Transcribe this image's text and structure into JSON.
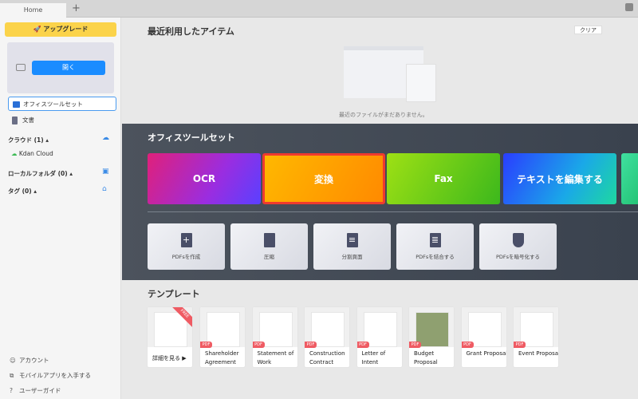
{
  "tabs": {
    "home": "Home",
    "add": "+"
  },
  "sidebar": {
    "upgrade": "アップグレード",
    "open": "開く",
    "items": [
      {
        "label": "オフィスツールセット"
      },
      {
        "label": "文書"
      }
    ],
    "cloud": "クラウド (1) ▴",
    "cloud_item": "Kdan Cloud",
    "local": "ローカルフォルダ (0) ▴",
    "tags": "タグ (0) ▴",
    "footer": [
      {
        "label": "アカウント",
        "icon": "user-icon"
      },
      {
        "label": "モバイルアプリを入手する",
        "icon": "mobile-icon"
      },
      {
        "label": "ユーザーガイド",
        "icon": "help-icon"
      }
    ]
  },
  "recent": {
    "title": "最近利用したアイテム",
    "clear": "クリア",
    "empty": "最近のファイルがまだありません。"
  },
  "office": {
    "title": "オフィスツールセット",
    "cards": [
      "OCR",
      "変換",
      "Fax",
      "テキストを編集する"
    ],
    "tools": [
      "PDFsを作成",
      "圧縮",
      "分割頁面",
      "PDFsを結合する",
      "PDFsを暗号化する"
    ]
  },
  "templates": {
    "title": "テンプレート",
    "more": "詳細を見る ▶",
    "ribbon": "FREE",
    "badge": "PDF",
    "items": [
      "Shareholder Agreement",
      "Statement of Work",
      "Construction Contract",
      "Letter of Intent",
      "Budget Proposal",
      "Grant Proposal",
      "Event Proposal"
    ]
  },
  "colors": {
    "accent": "#1a8cff",
    "upgrade": "#fbd34a",
    "selection": "#f03a2e"
  }
}
